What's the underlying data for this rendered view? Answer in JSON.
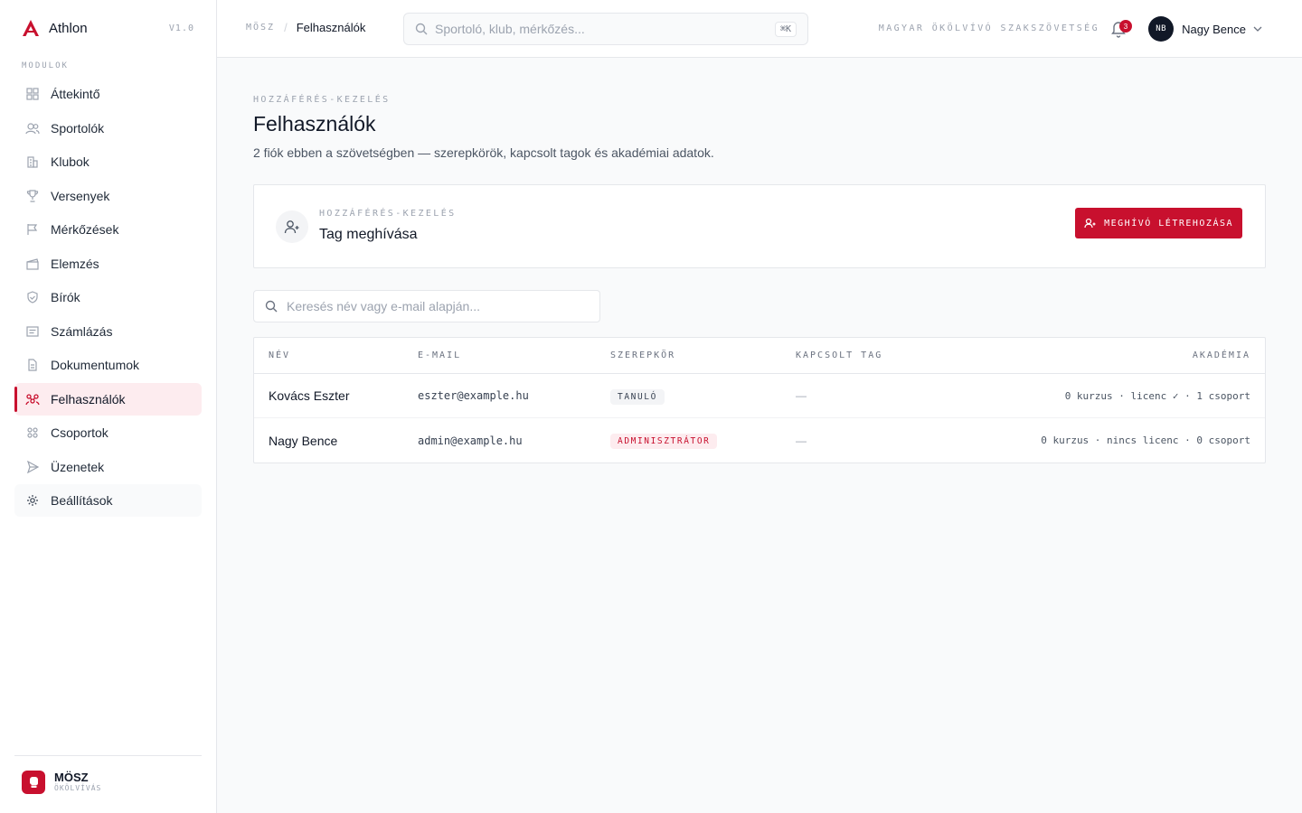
{
  "app": {
    "name": "Athlon",
    "version": "V1.0"
  },
  "sidebar": {
    "section_label": "MODULOK",
    "items": [
      {
        "label": "Áttekintő",
        "icon": "grid-icon"
      },
      {
        "label": "Sportolók",
        "icon": "users-icon"
      },
      {
        "label": "Klubok",
        "icon": "building-icon"
      },
      {
        "label": "Versenyek",
        "icon": "trophy-icon"
      },
      {
        "label": "Mérkőzések",
        "icon": "flag-icon"
      },
      {
        "label": "Elemzés",
        "icon": "clapperboard-icon"
      },
      {
        "label": "Bírók",
        "icon": "shield-icon"
      },
      {
        "label": "Számlázás",
        "icon": "receipt-icon"
      },
      {
        "label": "Dokumentumok",
        "icon": "document-icon"
      },
      {
        "label": "Felhasználók",
        "icon": "user-network-icon",
        "active": true
      },
      {
        "label": "Csoportok",
        "icon": "group-icon"
      },
      {
        "label": "Üzenetek",
        "icon": "send-icon"
      },
      {
        "label": "Beállítások",
        "icon": "gear-icon"
      }
    ],
    "footer": {
      "org_name": "MÖSZ",
      "org_sub": "ÖKÖLVÍVÁS"
    }
  },
  "topbar": {
    "breadcrumb_root": "MÖSZ",
    "breadcrumb_sep": "/",
    "breadcrumb_current": "Felhasználók",
    "search_placeholder": "Sportoló, klub, mérkőzés...",
    "search_shortcut": "⌘K",
    "federation": "MAGYAR ÖKÖLVÍVÓ SZAKSZÖVETSÉG",
    "notification_count": "3",
    "user_initials": "NB",
    "user_name": "Nagy Bence"
  },
  "page": {
    "eyebrow": "HOZZÁFÉRÉS-KEZELÉS",
    "title": "Felhasználók",
    "subtitle": "2 fiók ebben a szövetségben — szerepkörök, kapcsolt tagok és akadémiai adatok."
  },
  "invite": {
    "eyebrow": "HOZZÁFÉRÉS-KEZELÉS",
    "title": "Tag meghívása",
    "button": "MEGHÍVÓ LÉTREHOZÁSA"
  },
  "user_search": {
    "placeholder": "Keresés név vagy e-mail alapján..."
  },
  "table": {
    "headers": {
      "name": "NÉV",
      "email": "E-MAIL",
      "role": "SZEREPKÖR",
      "member": "KAPCSOLT TAG",
      "academy": "AKADÉMIA"
    },
    "rows": [
      {
        "name": "Kovács Eszter",
        "email": "eszter@example.hu",
        "role": "TANULÓ",
        "member": "—",
        "academy": "0 kurzus · licenc ✓ · 1 csoport"
      },
      {
        "name": "Nagy Bence",
        "email": "admin@example.hu",
        "role": "ADMINISZTRÁTOR",
        "member": "—",
        "academy": "0 kurzus · nincs licenc · 0 csoport"
      }
    ]
  },
  "colors": {
    "accent": "#c8102e",
    "accent_soft": "#fdecef",
    "text": "#111827",
    "muted": "#9ca3af",
    "border": "#e5e7eb"
  }
}
